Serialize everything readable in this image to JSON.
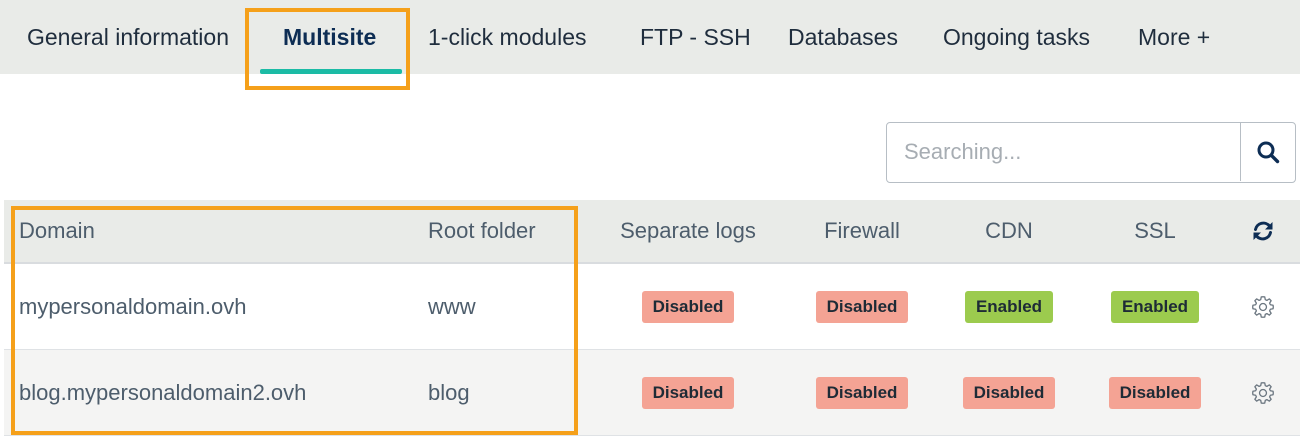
{
  "tabs": [
    {
      "label": "General information"
    },
    {
      "label": "Multisite",
      "active": true
    },
    {
      "label": "1-click modules"
    },
    {
      "label": "FTP - SSH"
    },
    {
      "label": "Databases"
    },
    {
      "label": "Ongoing tasks"
    },
    {
      "label": "More +"
    }
  ],
  "search": {
    "placeholder": "Searching...",
    "button_icon": "search-icon"
  },
  "table": {
    "columns": [
      "Domain",
      "Root folder",
      "Separate logs",
      "Firewall",
      "CDN",
      "SSL"
    ],
    "refresh_icon": "refresh-icon",
    "rows": [
      {
        "domain": "mypersonaldomain.ovh",
        "root_folder": "www",
        "separate_logs": "Disabled",
        "firewall": "Disabled",
        "cdn": "Enabled",
        "ssl": "Enabled",
        "action_icon": "gear-icon"
      },
      {
        "domain": "blog.mypersonaldomain2.ovh",
        "root_folder": "blog",
        "separate_logs": "Disabled",
        "firewall": "Disabled",
        "cdn": "Disabled",
        "ssl": "Disabled",
        "action_icon": "gear-icon"
      }
    ]
  },
  "colors": {
    "tab_active_underline": "#1bbba5",
    "highlight_outline": "#f5a01a",
    "badge_disabled": "#f4a394",
    "badge_enabled": "#9ccb4e",
    "header_bg": "#e9ebe8",
    "icon_color": "#0d2d54"
  }
}
